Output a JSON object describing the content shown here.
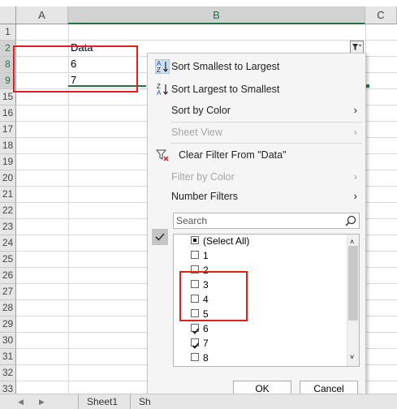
{
  "sheet": {
    "columns": [
      "A",
      "B",
      "C"
    ],
    "rows": [
      "1",
      "2",
      "8",
      "9",
      "15",
      "16",
      "17",
      "18",
      "19",
      "20",
      "21",
      "22",
      "23",
      "24",
      "25",
      "26",
      "27",
      "28",
      "29",
      "30",
      "31",
      "32",
      "33"
    ],
    "cells": {
      "b2": "Data",
      "b8": "6",
      "b9": "7"
    }
  },
  "menu": {
    "sort_asc": "Sort Smallest to Largest",
    "sort_desc": "Sort Largest to Smallest",
    "sort_color": "Sort by Color",
    "sheet_view": "Sheet View",
    "clear_filter": "Clear Filter From \"Data\"",
    "filter_color": "Filter by Color",
    "number_filters": "Number Filters",
    "search_placeholder": "Search",
    "items": [
      {
        "label": "(Select All)",
        "state": "partial"
      },
      {
        "label": "1",
        "state": "unchecked"
      },
      {
        "label": "2",
        "state": "unchecked"
      },
      {
        "label": "3",
        "state": "unchecked"
      },
      {
        "label": "4",
        "state": "unchecked"
      },
      {
        "label": "5",
        "state": "unchecked"
      },
      {
        "label": "6",
        "state": "checked"
      },
      {
        "label": "7",
        "state": "checked"
      },
      {
        "label": "8",
        "state": "unchecked"
      }
    ],
    "ok": "OK",
    "cancel": "Cancel"
  },
  "tabs": {
    "sheet1": "Sheet1",
    "sheet2_partial": "Sh"
  },
  "colors": {
    "excel_green": "#217346",
    "highlight_red": "#e02020",
    "checkmark_bg": "#c5c5c5"
  }
}
